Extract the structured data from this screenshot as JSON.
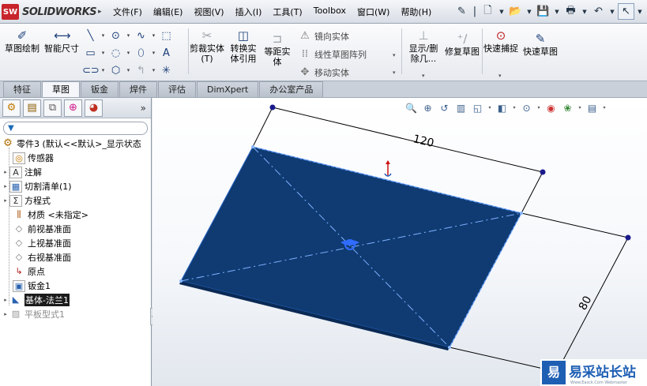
{
  "app": {
    "logo_mark": "SW",
    "logo_text": "SOLIDWORKS"
  },
  "menu": [
    "文件(F)",
    "编辑(E)",
    "视图(V)",
    "插入(I)",
    "工具(T)",
    "Toolbox",
    "窗口(W)",
    "帮助(H)"
  ],
  "ribbon": {
    "sketch": "草图绘制",
    "smart_dim": "智能尺寸",
    "trim": "剪裁实体(T)",
    "convert": "转换实体引用",
    "offset": "等距实体",
    "mirror": "镜向实体",
    "linear_pattern": "线性草图阵列",
    "move": "移动实体",
    "show_delete": "显示/删除几...",
    "repair": "修复草图",
    "quick_snaps": "快速捕捉",
    "rapid_sketch": "快速草图"
  },
  "tabs": [
    "特征",
    "草图",
    "钣金",
    "焊件",
    "评估",
    "DimXpert",
    "办公室产品"
  ],
  "active_tab": "草图",
  "feature_tree": {
    "root": "零件3  (默认<<默认>_显示状态",
    "items": [
      {
        "label": "传感器",
        "icon": "sensor-icon"
      },
      {
        "label": "注解",
        "icon": "annotation-icon"
      },
      {
        "label": "切割清单(1)",
        "icon": "cutlist-icon"
      },
      {
        "label": "方程式",
        "icon": "equation-icon"
      },
      {
        "label": "材质 <未指定>",
        "icon": "material-icon"
      },
      {
        "label": "前视基准面",
        "icon": "plane-icon"
      },
      {
        "label": "上视基准面",
        "icon": "plane-icon"
      },
      {
        "label": "右视基准面",
        "icon": "plane-icon"
      },
      {
        "label": "原点",
        "icon": "origin-icon"
      },
      {
        "label": "钣金1",
        "icon": "sheetmetal-icon"
      },
      {
        "label": "基体-法兰1",
        "icon": "base-flange-icon"
      },
      {
        "label": "平板型式1",
        "icon": "flat-pattern-icon"
      }
    ]
  },
  "model": {
    "dim_top": "120",
    "dim_right": "80",
    "plate_color": "#0f3b72"
  },
  "watermark": {
    "mark": "易",
    "text": "易采站长站",
    "sub": "Www.Easck.Com Webmaster"
  }
}
